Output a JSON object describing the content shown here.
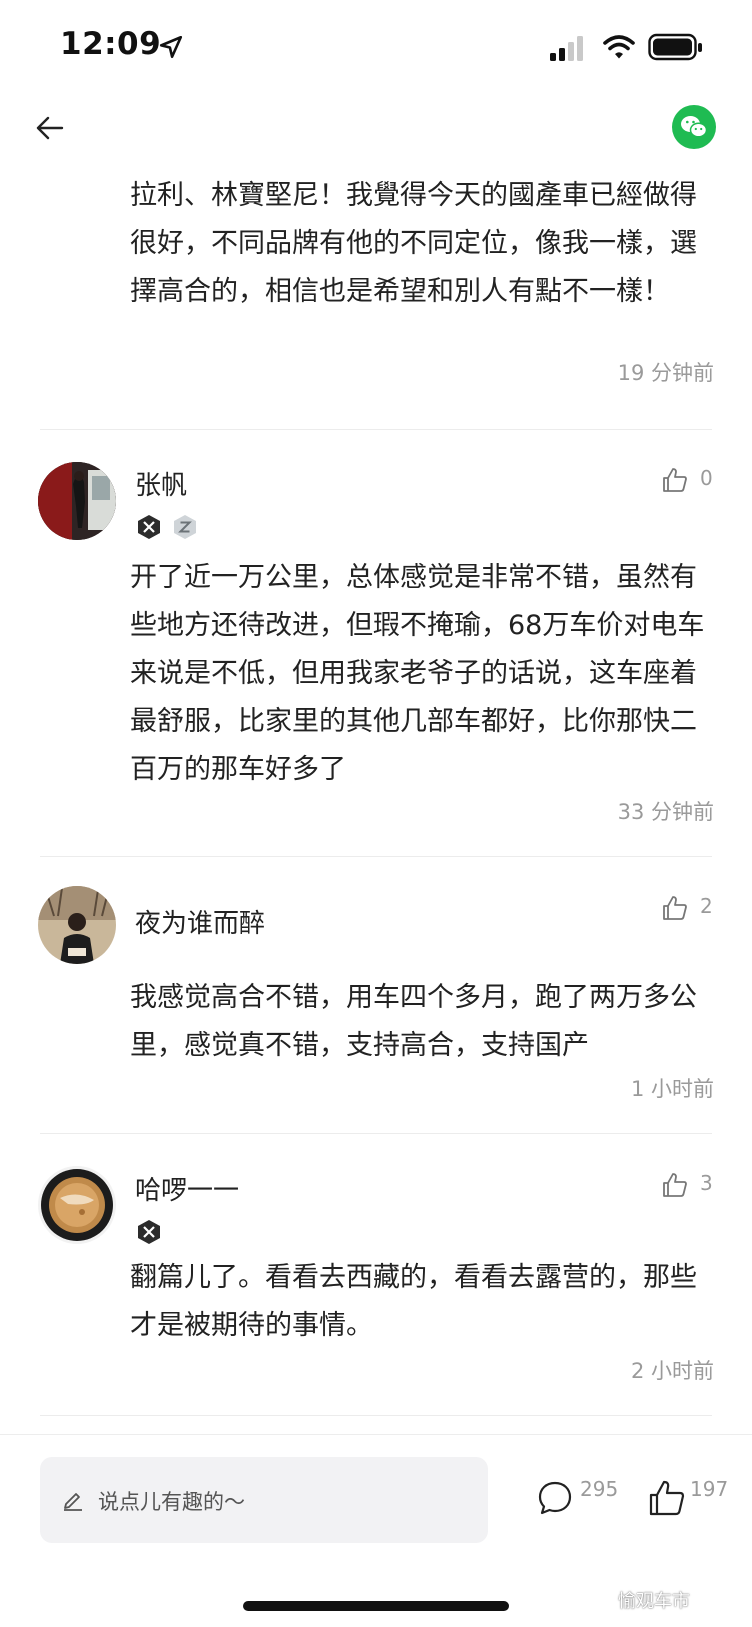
{
  "status_bar": {
    "time": "12:09"
  },
  "comments": [
    {
      "text": "拉利、林寶堅尼！我覺得今天的國產車已經做得很好，不同品牌有他的不同定位，像我一樣，選擇高合的，相信也是希望和別人有點不一樣！",
      "time": "19 分钟前"
    },
    {
      "user": "张帆",
      "likes": "0",
      "text": "开了近一万公里，总体感觉是非常不错，虽然有些地方还待改进，但瑕不掩瑜，68万车价对电车来说是不低，但用我家老爷子的话说，这车座着最舒服，比家里的其他几部车都好，比你那快二百万的那车好多了",
      "time": "33 分钟前"
    },
    {
      "user": "夜为谁而醉",
      "likes": "2",
      "text": "我感觉高合不错，用车四个多月，跑了两万多公里，感觉真不错，支持高合，支持国产",
      "time": "1 小时前"
    },
    {
      "user": "哈啰一一",
      "likes": "3",
      "text": "翻篇儿了。看看去西藏的，看看去露营的，那些才是被期待的事情。",
      "time": "2 小时前"
    }
  ],
  "bottom_bar": {
    "placeholder": "说点儿有趣的～",
    "comment_count": "295",
    "like_count": "197"
  },
  "watermark": "愉观车市"
}
